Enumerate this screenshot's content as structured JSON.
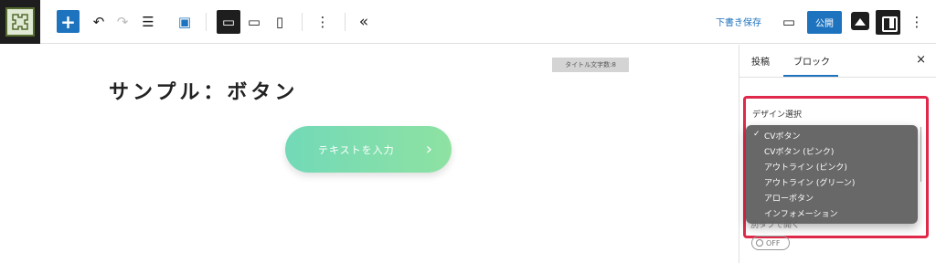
{
  "toolbar": {
    "add_icon": "+",
    "undo_icon": "↶",
    "redo_icon": "↷",
    "list_icon": "☰",
    "preview_icon": "▣",
    "device_desktop_icon": "▭",
    "device_tablet_icon": "▭",
    "device_mobile_icon": "▯",
    "more_icon": "⋮",
    "collapse_icon": "«",
    "draft_label": "下書き保存",
    "view_icon": "▭",
    "publish_label": "公開",
    "options_icon": "⋮"
  },
  "canvas": {
    "title_count": "タイトル文字数:8",
    "page_title": "サンプル：ボタン",
    "cta_text": "テキストを入力",
    "cta_arrow": "›"
  },
  "panel": {
    "tab_post": "投稿",
    "tab_block": "ブロック",
    "close_icon": "×",
    "field_label": "デザイン選択",
    "partial_label": "別タブで開く",
    "toggle_label": "OFF",
    "options": [
      "CVボタン",
      "CVボタン (ピンク)",
      "アウトライン (ピンク)",
      "アウトライン (グリーン)",
      "アローボタン",
      "インフォメーション"
    ],
    "selected_index": 0
  },
  "colors": {
    "accent": "#1e73be",
    "highlight": "#e0294a",
    "cta_start": "#72d9b8",
    "cta_end": "#8ee2a2"
  }
}
